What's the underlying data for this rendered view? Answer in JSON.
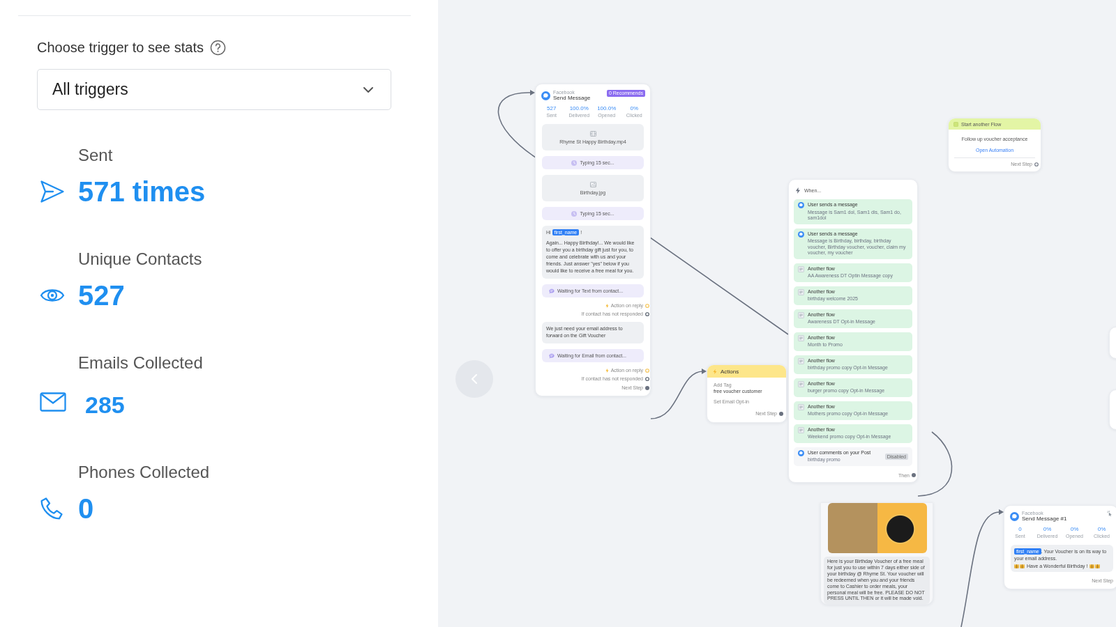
{
  "sidebar": {
    "trigger_label": "Choose trigger to see stats",
    "trigger_select": {
      "value": "All triggers"
    },
    "stats": [
      {
        "kind": "sent",
        "label": "Sent",
        "value": "571 times"
      },
      {
        "kind": "contacts",
        "label": "Unique Contacts",
        "value": "527"
      },
      {
        "kind": "emails",
        "label": "Emails Collected",
        "value": "285"
      },
      {
        "kind": "phones",
        "label": "Phones Collected",
        "value": "0"
      }
    ]
  },
  "canvas": {
    "send_message": {
      "source": "Facebook",
      "title": "Send Message",
      "badge": "0 Recommends",
      "stats": [
        {
          "value": "527",
          "label": "Sent"
        },
        {
          "value": "100.0%",
          "label": "Delivered"
        },
        {
          "value": "100.0%",
          "label": "Opened"
        },
        {
          "value": "0%",
          "label": "Clicked"
        }
      ],
      "steps": [
        {
          "kind": "video",
          "name": "Rhyme St Happy Birthday.mp4"
        },
        {
          "kind": "typing",
          "text": "Typing 15 sec..."
        },
        {
          "kind": "image",
          "name": "Birthday.jpg"
        },
        {
          "kind": "typing",
          "text": "Typing 15 sec..."
        },
        {
          "kind": "text",
          "prefix": "Hi",
          "tag": "first_name",
          "suffix": "!",
          "body": "Again... Happy Birthday!... We would like to offer you a birthday gift just for you, to come and celebrate with us and your friends. Just answer \"yes\" below if you would like to receive a free meal for you."
        },
        {
          "kind": "waiting",
          "text": "Waiting for Text from contact..."
        },
        {
          "kind": "reply_branch",
          "on_reply": "Action on reply",
          "no_reply": "If contact has not responded"
        },
        {
          "kind": "text",
          "body": "We just need your email address to forward on the Gift Voucher"
        },
        {
          "kind": "waiting",
          "text": "Waiting for Email from contact..."
        },
        {
          "kind": "reply_branch",
          "on_reply": "Action on reply",
          "no_reply": "If contact has not responded"
        }
      ],
      "next_step": "Next Step"
    },
    "actions": {
      "title": "Actions",
      "items": [
        {
          "label": "Add Tag",
          "value": "free voucher customer"
        },
        {
          "label": "Set Email Opt-in"
        }
      ],
      "next_step": "Next Step"
    },
    "when": {
      "title": "When...",
      "triggers": [
        {
          "kind": "message",
          "title": "User sends a message",
          "detail": "Message is Sam1 dol, Sam1 dis, Sam1 do, sam1dol"
        },
        {
          "kind": "message",
          "title": "User sends a message",
          "detail": "Message is Birthday, birthday, birthday voucher, Birthday voucher, voucher, claim my voucher, my voucher"
        },
        {
          "kind": "flow",
          "title": "Another flow",
          "detail": "AA Awareness DT Optin Message copy"
        },
        {
          "kind": "flow",
          "title": "Another flow",
          "detail": "birthday welcome 2025"
        },
        {
          "kind": "flow",
          "title": "Another flow",
          "detail": "Awareness DT Opt-in Message"
        },
        {
          "kind": "flow",
          "title": "Another flow",
          "detail": "Month to Promo"
        },
        {
          "kind": "flow",
          "title": "Another flow",
          "detail": "birthday promo copy Opt-in Message"
        },
        {
          "kind": "flow",
          "title": "Another flow",
          "detail": "burger promo copy Opt-in Message"
        },
        {
          "kind": "flow",
          "title": "Another flow",
          "detail": "Mothers promo copy Opt-in Message"
        },
        {
          "kind": "flow",
          "title": "Another flow",
          "detail": "Weekend promo copy Opt-in Message"
        },
        {
          "kind": "comment",
          "title": "User comments on your Post",
          "detail": "birthday promo",
          "badge": "Disabled"
        }
      ],
      "then": "Then"
    },
    "start_flow": {
      "title": "Start another Flow",
      "description": "Follow up voucher acceptance",
      "link": "Open Automation",
      "next_step": "Next Step"
    },
    "voucher_message": {
      "text": "Here is your Birthday Voucher of a free meal for just you to use within 7 days either side of your birthday @ Rhyme St. Your voucher will be redeemed when you and your friends come to Cashier to order meals, your personal meal will be free. PLEASE DO NOT PRESS UNTIL THEN or it will be made void."
    },
    "send_message_2": {
      "source": "Facebook",
      "title": "Send Message #1",
      "stats": [
        {
          "value": "0",
          "label": "Sent"
        },
        {
          "value": "0%",
          "label": "Delivered"
        },
        {
          "value": "0%",
          "label": "Opened"
        },
        {
          "value": "0%",
          "label": "Clicked"
        }
      ],
      "message": {
        "tag": "first_name",
        "text": ". Your Voucher is on its way to your email address.",
        "closing": "Have a Wonderful Birthday !"
      },
      "next_step": "Next Step"
    }
  }
}
